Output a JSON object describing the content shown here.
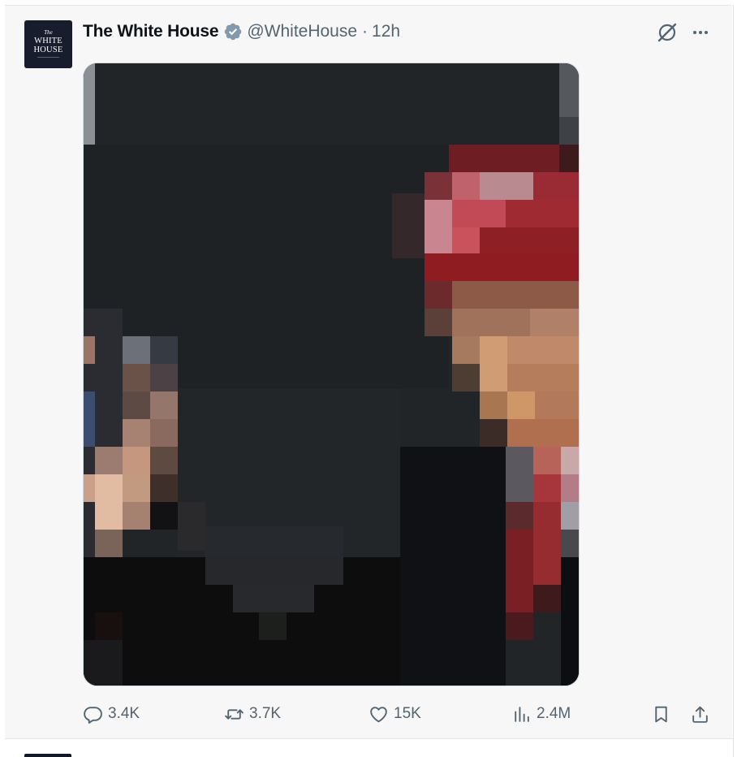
{
  "account": {
    "display_name": "The White House",
    "handle": "@WhiteHouse",
    "separator": "·",
    "timestamp": "12h",
    "avatar_text": {
      "line1": "The",
      "line2": "WHITE",
      "line3": "HOUSE"
    },
    "verified_icon": "verified-badge-icon",
    "verified_color": "#829aab"
  },
  "header_actions": {
    "grok_icon": "grok-icon",
    "more_icon": "more-options-icon"
  },
  "media": {
    "kind": "pixelated-photo",
    "description_icon": "image-icon"
  },
  "engagement": {
    "replies": "3.4K",
    "reposts": "3.7K",
    "likes": "15K",
    "views": "2.4M",
    "icons": {
      "reply": "reply-icon",
      "repost": "repost-icon",
      "like": "heart-icon",
      "views": "views-chart-icon",
      "bookmark": "bookmark-icon",
      "share": "share-icon"
    }
  },
  "colors": {
    "text_primary": "#0f1419",
    "text_secondary": "#536471",
    "background": "#f7f7f7"
  }
}
